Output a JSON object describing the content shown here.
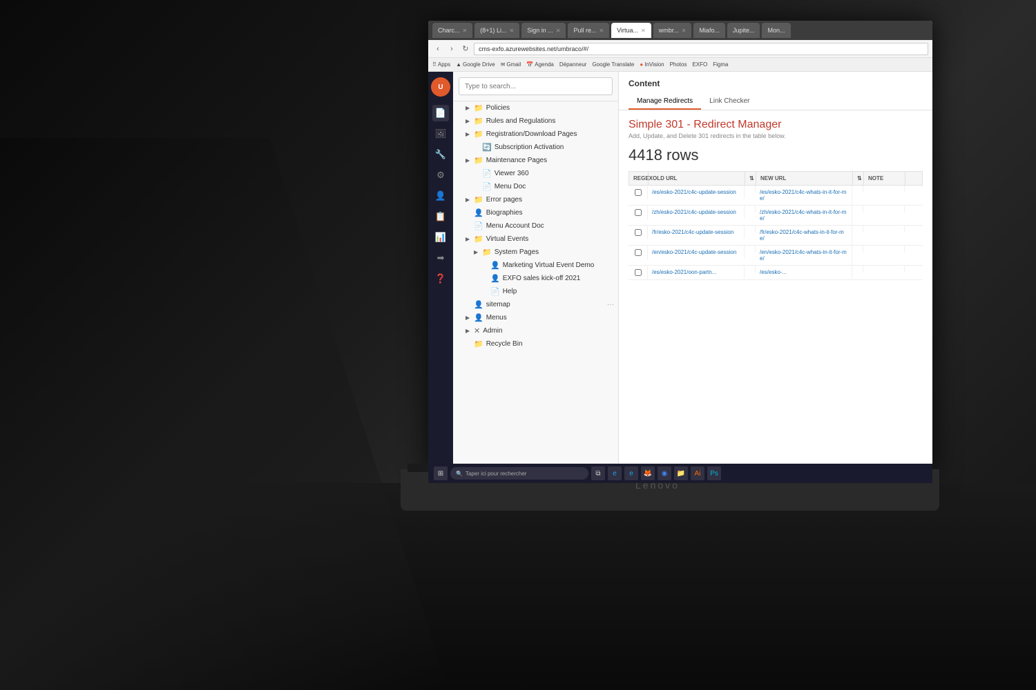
{
  "browser": {
    "tabs": [
      {
        "label": "Charc...",
        "active": false
      },
      {
        "label": "(8+1) Li...",
        "active": false
      },
      {
        "label": "Sign in ...",
        "active": false
      },
      {
        "label": "Pull re...",
        "active": false
      },
      {
        "label": "Virtua...",
        "active": true
      },
      {
        "label": "wmbr...",
        "active": false
      },
      {
        "label": "Miafo...",
        "active": false
      },
      {
        "label": "Jupite...",
        "active": false
      },
      {
        "label": "Mon...",
        "active": false
      }
    ],
    "address": "cms-exfo.azurewebsites.net/umbraco/#/",
    "bookmarks": [
      "Apps",
      "Google Drive",
      "Gmail",
      "Agenda",
      "Dépanneur",
      "Google Translate",
      "InVision",
      "Photos",
      "EXFO",
      "Figma"
    ]
  },
  "sidebar": {
    "icons": [
      "📄",
      "🖼",
      "🔧",
      "⚙",
      "👤",
      "📋",
      "📊",
      "➡",
      "❓"
    ]
  },
  "search": {
    "placeholder": "Type to search..."
  },
  "tree": {
    "items": [
      {
        "label": "Policies",
        "indent": 1,
        "hasChevron": true,
        "icon": "folder"
      },
      {
        "label": "Rules and Regulations",
        "indent": 1,
        "hasChevron": true,
        "icon": "folder"
      },
      {
        "label": "Registration/Download Pages",
        "indent": 1,
        "hasChevron": true,
        "icon": "folder"
      },
      {
        "label": "Subscription Activation",
        "indent": 2,
        "hasChevron": false,
        "icon": "clock"
      },
      {
        "label": "Maintenance Pages",
        "indent": 1,
        "hasChevron": true,
        "icon": "folder"
      },
      {
        "label": "Viewer 360",
        "indent": 2,
        "hasChevron": false,
        "icon": "doc"
      },
      {
        "label": "Menu Doc",
        "indent": 2,
        "hasChevron": false,
        "icon": "doc"
      },
      {
        "label": "Error pages",
        "indent": 1,
        "hasChevron": true,
        "icon": "folder"
      },
      {
        "label": "Biographies",
        "indent": 1,
        "hasChevron": false,
        "icon": "person"
      },
      {
        "label": "Menu Account Doc",
        "indent": 1,
        "hasChevron": false,
        "icon": "doc"
      },
      {
        "label": "Virtual Events",
        "indent": 1,
        "hasChevron": true,
        "icon": "folder"
      },
      {
        "label": "System Pages",
        "indent": 2,
        "hasChevron": true,
        "icon": "folder"
      },
      {
        "label": "Marketing Virtual Event Demo",
        "indent": 3,
        "hasChevron": false,
        "icon": "person"
      },
      {
        "label": "EXFO sales kick-off 2021",
        "indent": 3,
        "hasChevron": false,
        "icon": "person"
      },
      {
        "label": "Help",
        "indent": 3,
        "hasChevron": false,
        "icon": "doc"
      },
      {
        "label": "sitemap",
        "indent": 1,
        "hasChevron": false,
        "icon": "person",
        "hasMore": true
      },
      {
        "label": "Menus",
        "indent": 1,
        "hasChevron": true,
        "icon": "person"
      },
      {
        "label": "Admin",
        "indent": 1,
        "hasChevron": true,
        "icon": "x"
      },
      {
        "label": "Recycle Bin",
        "indent": 1,
        "hasChevron": false,
        "icon": "folder"
      }
    ]
  },
  "content": {
    "title": "Content",
    "tabs": [
      "Manage Redirects",
      "Link Checker"
    ],
    "active_tab": "Manage Redirects"
  },
  "redirect_manager": {
    "title": "Simple 301 - Redirect Manager",
    "subtitle": "Add, Update, and Delete 301 redirects in the table below.",
    "row_count": "4418 rows",
    "table_headers": [
      "REGEX",
      "OLD URL",
      "",
      "NEW URL",
      "",
      "NOTE"
    ],
    "rows": [
      {
        "regex": false,
        "old_url": "/es/esko-2021/c4c-update-session",
        "new_url": "/es/esko-2021/c4c-whats-in-it-for-me/"
      },
      {
        "regex": false,
        "old_url": "/zh/esko-2021/c4c-update-session",
        "new_url": "/zh/esko-2021/c4c-whats-in-it-for-me/"
      },
      {
        "regex": false,
        "old_url": "/fr/esko-2021/c4c-update-session",
        "new_url": "/fr/esko-2021/c4c-whats-in-it-for-me/"
      },
      {
        "regex": false,
        "old_url": "/en/esko-2021/c4c-update-session",
        "new_url": "/en/esko-2021/c4c-whats-in-it-for-me/"
      },
      {
        "regex": false,
        "old_url": "/es/esko-2021/oon-partn...",
        "new_url": "/es/esko-..."
      }
    ]
  },
  "taskbar": {
    "search_placeholder": "Taper ici pour rechercher"
  }
}
